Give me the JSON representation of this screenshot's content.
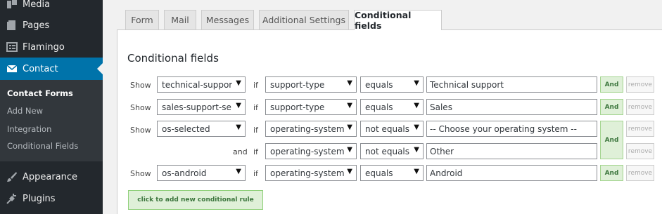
{
  "sidebar": {
    "media": "Media",
    "pages": "Pages",
    "flamingo": "Flamingo",
    "contact": "Contact",
    "submenu": [
      "Contact Forms",
      "Add New",
      "Integration",
      "Conditional Fields"
    ],
    "appearance": "Appearance",
    "plugins": "Plugins"
  },
  "tabs": [
    "Form",
    "Mail",
    "Messages",
    "Additional Settings",
    "Conditional fields"
  ],
  "panel": {
    "title": "Conditional fields"
  },
  "rules": [
    {
      "show": "Show",
      "field": "technical-suppor",
      "if": "if",
      "cond_field": "support-type",
      "operator": "equals",
      "value": "Technical support",
      "and_label": "And",
      "remove_label": "remove"
    },
    {
      "show": "Show",
      "field": "sales-support-se",
      "if": "if",
      "cond_field": "support-type",
      "operator": "equals",
      "value": "Sales",
      "and_label": "And",
      "remove_label": "remove"
    },
    {
      "show": "Show",
      "field": "os-selected",
      "if": "if",
      "cond_field": "operating-system",
      "operator": "not equals",
      "value": "-- Choose your operating system --",
      "and_label": "And",
      "remove_label": "remove"
    },
    {
      "and_text": "and",
      "if": "if",
      "cond_field": "operating-system",
      "operator": "not equals",
      "value": "Other",
      "remove_label": "remove"
    },
    {
      "show": "Show",
      "field": "os-android",
      "if": "if",
      "cond_field": "operating-system",
      "operator": "equals",
      "value": "Android",
      "and_label": "And",
      "remove_label": "remove"
    }
  ],
  "add_rule_label": "click to add new conditional rule",
  "colors": {
    "sidebar_bg": "#23282d",
    "active_menu": "#0073aa",
    "and_button_bg": "#dff0d8"
  }
}
